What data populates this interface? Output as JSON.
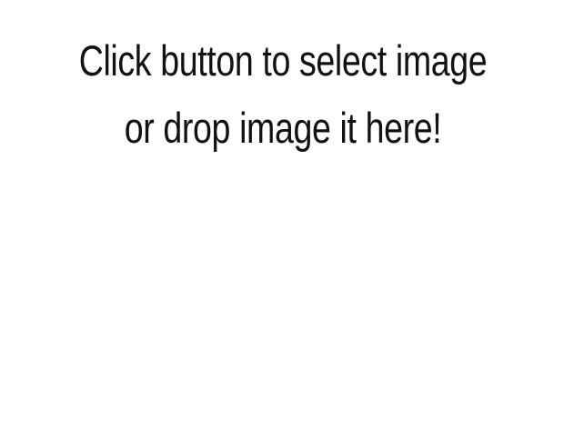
{
  "drop_zone": {
    "message_line_1": "Click button to select image",
    "message_line_2": "or drop image it here!"
  },
  "colors": {
    "background": "#ffffff",
    "text": "#111111"
  }
}
